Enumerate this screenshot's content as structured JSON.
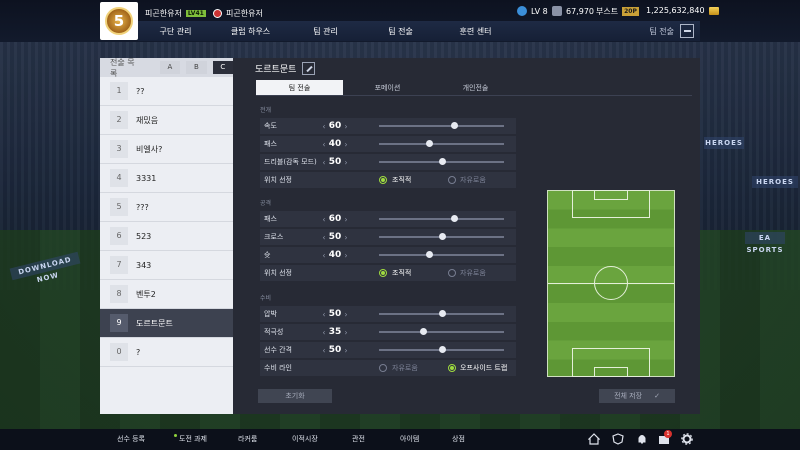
{
  "header": {
    "team_name": "피곤한유저",
    "level_tag": "LV41",
    "club_name": "피곤한유저",
    "logo_text": "5",
    "level": "LV 8",
    "ovr": "67,970",
    "boost_label": "부스트",
    "boost_badge": "20P",
    "coins": "1,225,632,840"
  },
  "nav": {
    "items": [
      "구단 관리",
      "클럽 하우스",
      "팀 관리",
      "팀 전술",
      "훈련 센터"
    ],
    "right_label": "팀 전술"
  },
  "left_panel": {
    "header_label": "전술 목록",
    "tabs": [
      "A",
      "B",
      "C"
    ],
    "active_tab": "C",
    "slots": [
      {
        "num": "1",
        "name": "??"
      },
      {
        "num": "2",
        "name": "재밌음"
      },
      {
        "num": "3",
        "name": "비엘사?"
      },
      {
        "num": "4",
        "name": "3331"
      },
      {
        "num": "5",
        "name": "???"
      },
      {
        "num": "6",
        "name": "523"
      },
      {
        "num": "7",
        "name": "343"
      },
      {
        "num": "8",
        "name": "벤투2"
      },
      {
        "num": "9",
        "name": "도르트문트"
      },
      {
        "num": "0",
        "name": "?"
      }
    ],
    "active_slot": "9"
  },
  "main": {
    "title": "도르트문트",
    "tabs": [
      "팀 전술",
      "포메이션",
      "개인전술"
    ],
    "active_tab": "팀 전술",
    "sections": {
      "build": {
        "title": "전개",
        "rows": [
          {
            "label": "속도",
            "value": "60",
            "fraction": 0.6
          },
          {
            "label": "패스",
            "value": "40",
            "fraction": 0.4
          },
          {
            "label": "드리블(감독 모드)",
            "value": "50",
            "fraction": 0.5
          }
        ],
        "position": {
          "label": "위치 선정",
          "opt1": "조직적",
          "opt2": "자유로움",
          "selected": "조직적"
        }
      },
      "attack": {
        "title": "공격",
        "rows": [
          {
            "label": "패스",
            "value": "60",
            "fraction": 0.6
          },
          {
            "label": "크로스",
            "value": "50",
            "fraction": 0.5
          },
          {
            "label": "슛",
            "value": "40",
            "fraction": 0.4
          }
        ],
        "position": {
          "label": "위치 선정",
          "opt1": "조직적",
          "opt2": "자유로움",
          "selected": "조직적"
        }
      },
      "defense": {
        "title": "수비",
        "rows": [
          {
            "label": "압박",
            "value": "50",
            "fraction": 0.5
          },
          {
            "label": "적극성",
            "value": "35",
            "fraction": 0.35
          },
          {
            "label": "선수 간격",
            "value": "50",
            "fraction": 0.5
          }
        ],
        "line": {
          "label": "수비 라인",
          "opt1": "자유로움",
          "opt2": "오프사이드 트랩",
          "selected": "오프사이드 트랩"
        }
      }
    },
    "reset_button": "초기화",
    "save_button": "전체 저장"
  },
  "bottom": {
    "items": [
      "선수 등록",
      "도전 과제",
      "라커룸",
      "이적시장",
      "관전",
      "아이템",
      "상점"
    ],
    "notif_count": "1"
  },
  "background": {
    "ad1": "DOWNLOAD NOW",
    "ad2": "HEROES",
    "ad3": "HEROES",
    "ad4": "EA SPORTS"
  },
  "colors": {
    "accent": "#9fdb3f",
    "panel": "#272a35",
    "pitch": "#6aa43e"
  }
}
